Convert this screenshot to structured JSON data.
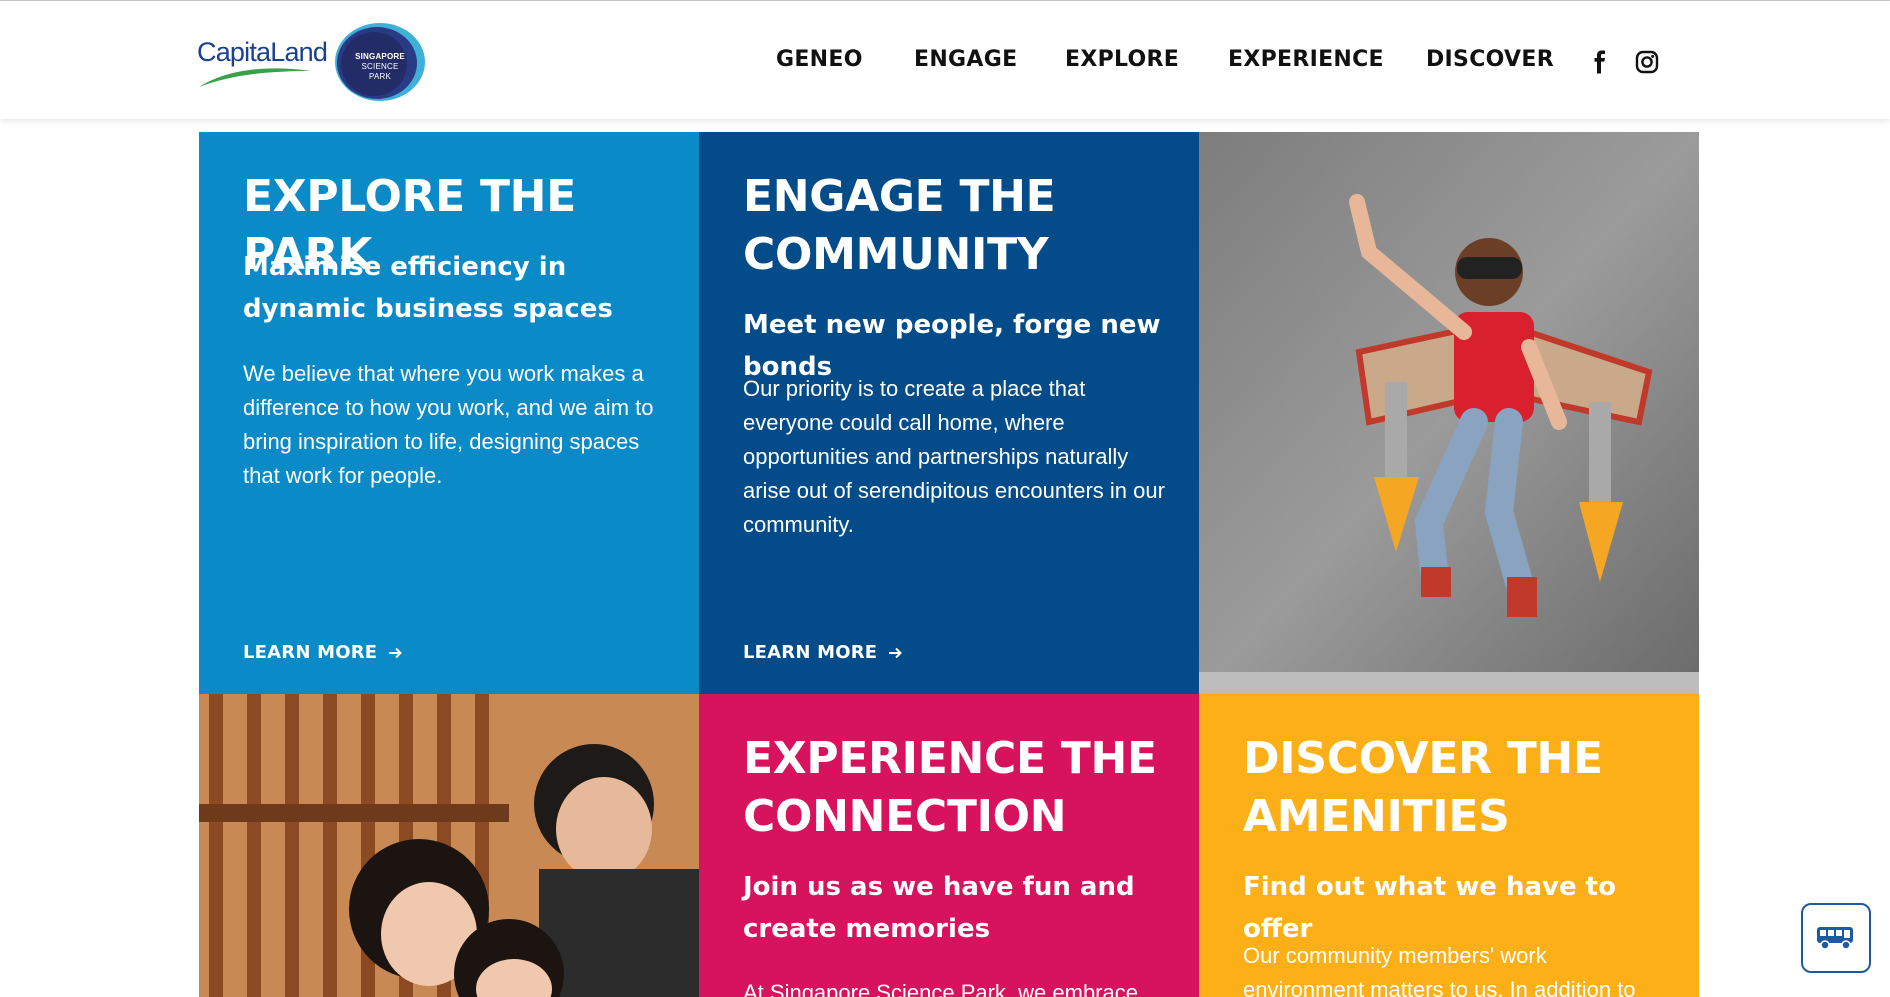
{
  "header": {
    "brand": {
      "capitaland": "CapitaLand",
      "ssp_line1": "SINGAPORE",
      "ssp_line2": "SCIENCE",
      "ssp_line3": "PARK"
    },
    "nav": [
      {
        "label": "GENEO"
      },
      {
        "label": "ENGAGE"
      },
      {
        "label": "EXPLORE"
      },
      {
        "label": "EXPERIENCE"
      },
      {
        "label": "DISCOVER"
      }
    ],
    "social": [
      "facebook-icon",
      "instagram-icon"
    ]
  },
  "tiles": [
    {
      "title": "EXPLORE THE PARK",
      "subtitle": "Maximise efficiency in dynamic business spaces",
      "body": "We believe that where you work makes a difference to how you work, and we aim to bring inspiration to life, designing spaces that work for people.",
      "cta": "LEARN MORE",
      "color": "#0a8ac7"
    },
    {
      "title": "ENGAGE THE\nCOMMUNITY",
      "subtitle": "Meet new people, forge new bonds",
      "body": "Our priority is to create a place that everyone could call home, where opportunities and partnerships naturally arise out of serendipitous encounters in our community.",
      "cta": "LEARN MORE",
      "color": "#044c89"
    },
    {
      "image": "kid-with-cardboard-jetpack-photo",
      "color": "#8a8a8a"
    },
    {
      "image": "friends-laughing-photo",
      "color": "#b5733f"
    },
    {
      "title": "EXPERIENCE THE\nCONNECTION",
      "subtitle": "Join us as we have fun and create memories",
      "body": "At Singapore Science Park, we embrace the",
      "color": "#d8135d"
    },
    {
      "title": "DISCOVER THE\nAMENITIES",
      "subtitle": "Find out what we have to offer",
      "body": "Our community members' work environment matters to us. In addition to",
      "color": "#fcaf17"
    }
  ],
  "floating": {
    "icon": "bus-icon"
  }
}
